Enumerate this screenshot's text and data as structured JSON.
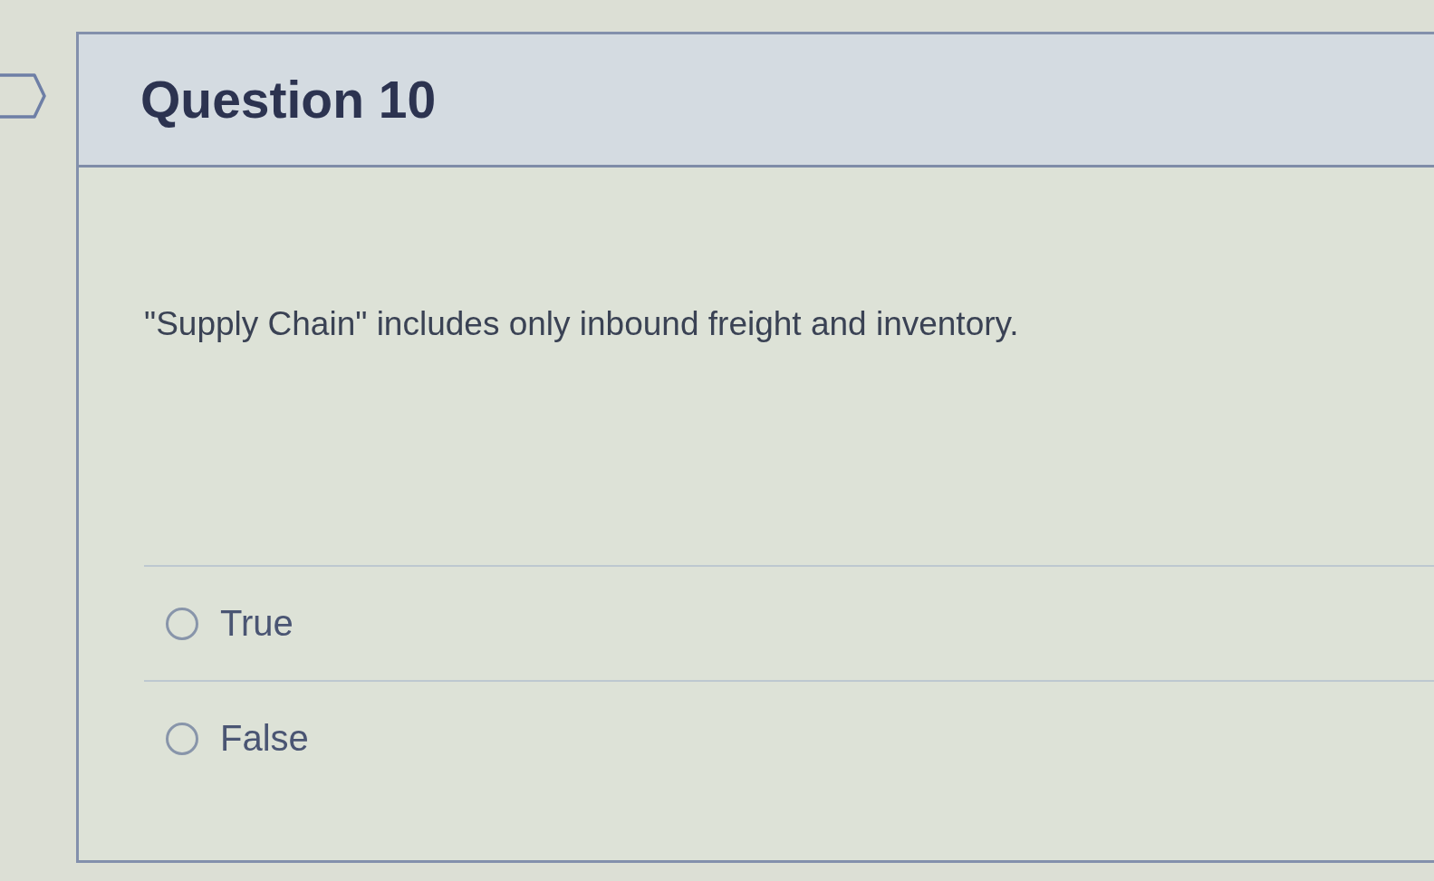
{
  "question": {
    "title": "Question 10",
    "text": "\"Supply Chain\" includes only inbound freight and inventory.",
    "options": [
      {
        "label": "True",
        "selected": false
      },
      {
        "label": "False",
        "selected": false
      }
    ]
  }
}
